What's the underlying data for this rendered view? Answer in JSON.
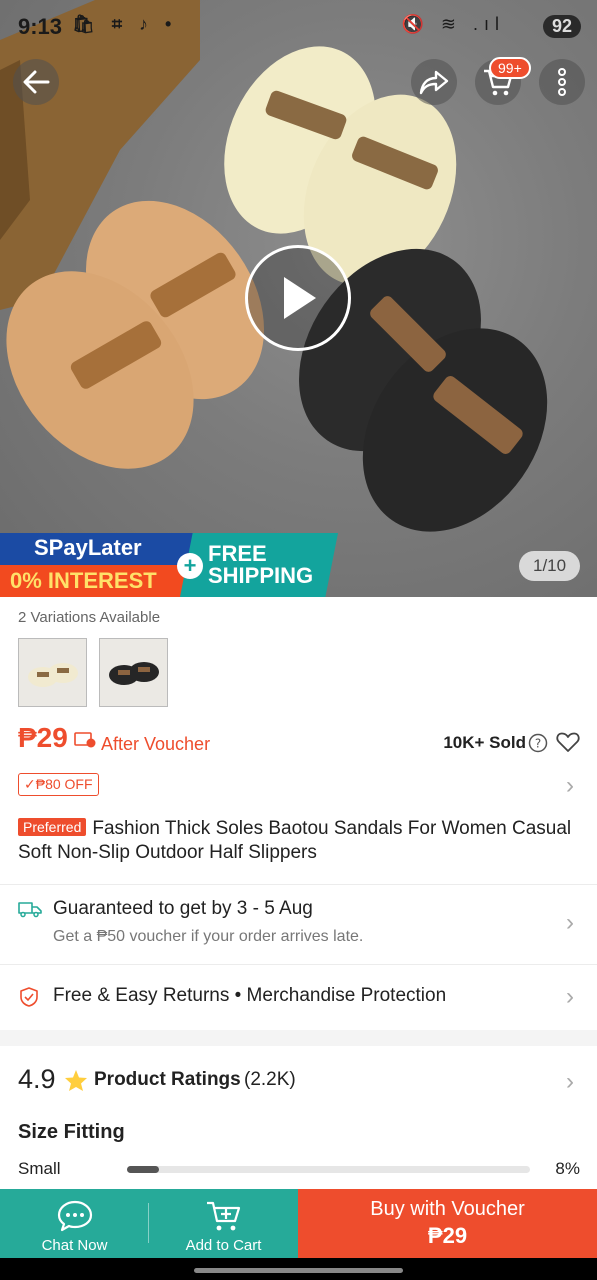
{
  "status_bar": {
    "time": "9:13",
    "left_icons": "🛍 ⌗ ♪ •",
    "right_icons": "🔇 ≋ .ıl",
    "battery": "92"
  },
  "top_nav": {
    "back_icon": "back-arrow-icon",
    "share_icon": "share-icon",
    "cart_icon": "cart-icon",
    "cart_badge": "99+",
    "more_icon": "more-vertical-icon"
  },
  "hero": {
    "promo_spaylater": "SPayLater",
    "promo_interest": "0% INTEREST",
    "promo_free": "FREE",
    "promo_shipping": "SHIPPING",
    "promo_plus": "+",
    "image_counter": "1/10"
  },
  "variations": {
    "label": "2 Variations Available"
  },
  "pricing": {
    "price": "₱29",
    "after_voucher": "After Voucher",
    "sold": "10K+ Sold",
    "discount_badge": "✓₱80 OFF"
  },
  "product": {
    "preferred_badge": "Preferred",
    "title": "Fashion Thick Soles Baotou Sandals For Women Casual Soft Non-Slip Outdoor Half Slippers"
  },
  "shipping": {
    "title": "Guaranteed to get by 3 - 5 Aug",
    "subtitle": "Get a ₱50 voucher if your order arrives late."
  },
  "returns": {
    "text": "Free & Easy Returns  •  Merchandise Protection"
  },
  "ratings": {
    "score": "4.9",
    "label": "Product Ratings",
    "count": "(2.2K)"
  },
  "size_fitting": {
    "title": "Size Fitting",
    "rows": [
      {
        "label": "Small",
        "percent_text": "8%",
        "fraction": 0.08
      }
    ]
  },
  "bottom_bar": {
    "chat_label": "Chat Now",
    "cart_label": "Add to Cart",
    "buy_label": "Buy with Voucher",
    "buy_price": "₱29"
  },
  "colors": {
    "accent": "#ee4d2d",
    "teal": "#26aa99"
  }
}
